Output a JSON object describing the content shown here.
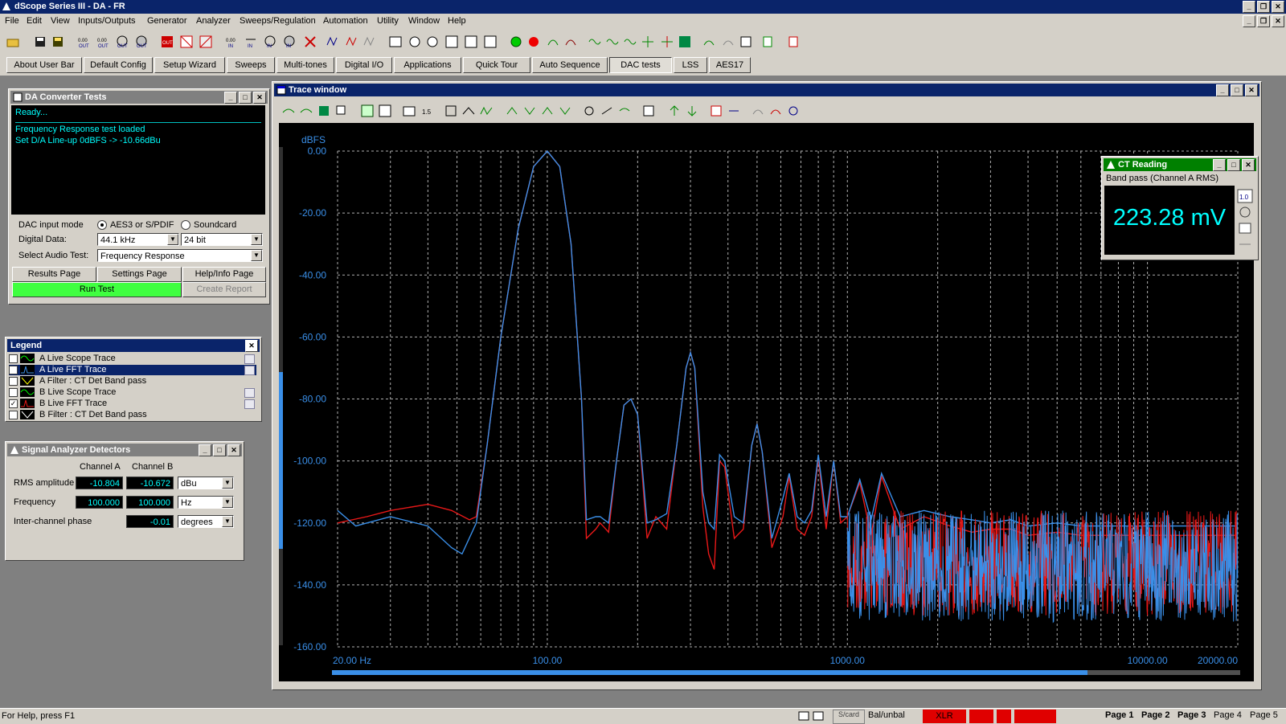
{
  "app": {
    "title": "dScope Series III - DA - FR",
    "menu": [
      "File",
      "Edit",
      "View",
      "Inputs/Outputs",
      "Generator",
      "Analyzer",
      "Sweeps/Regulation",
      "Automation",
      "Utility",
      "Window",
      "Help"
    ]
  },
  "user_bar": {
    "buttons": [
      "About User Bar",
      "Default Config",
      "Setup Wizard",
      "Sweeps",
      "Multi-tones",
      "Digital I/O",
      "Applications",
      "Quick Tour",
      "Auto Sequence",
      "DAC tests",
      "LSS",
      "AES17"
    ],
    "active": "DAC tests"
  },
  "da_panel": {
    "title": "DA Converter Tests",
    "log": [
      "Ready...",
      "Frequency Response test loaded",
      "Set D/A Line-up 0dBFS -> -10.66dBu"
    ],
    "dac_input_label": "DAC input mode",
    "dac_input_options": [
      "AES3 or S/PDIF",
      "Soundcard"
    ],
    "dac_input_selected": "AES3 or S/PDIF",
    "digital_data_label": "Digital Data:",
    "sample_rate": "44.1 kHz",
    "bit_depth": "24 bit",
    "select_test_label": "Select Audio Test:",
    "selected_test": "Frequency Response",
    "buttons": {
      "results": "Results Page",
      "settings": "Settings Page",
      "help": "Help/Info Page",
      "run": "Run Test",
      "report": "Create Report"
    }
  },
  "legend": {
    "title": "Legend",
    "items": [
      {
        "label": "A  Live Scope Trace",
        "checked": false
      },
      {
        "label": "A  Live FFT Trace",
        "checked": true,
        "selected": true
      },
      {
        "label": "A  Filter : CT Det Band pass",
        "checked": false
      },
      {
        "label": "B  Live Scope Trace",
        "checked": false
      },
      {
        "label": "B  Live FFT Trace",
        "checked": true
      },
      {
        "label": "B  Filter : CT Det Band pass",
        "checked": false
      }
    ]
  },
  "detectors": {
    "title": "Signal Analyzer Detectors",
    "col_a": "Channel A",
    "col_b": "Channel B",
    "rms_label": "RMS amplitude",
    "rms_a": "-10.804",
    "rms_b": "-10.672",
    "rms_unit": "dBu",
    "freq_label": "Frequency",
    "freq_a": "100.000",
    "freq_b": "100.000",
    "freq_unit": "Hz",
    "phase_label": "Inter-channel phase",
    "phase_val": "-0.01",
    "phase_unit": "degrees"
  },
  "trace_window": {
    "title": "Trace window"
  },
  "ct_reading": {
    "title": "CT Reading",
    "subtitle": "Band pass (Channel A RMS)",
    "value": "223.28 mV"
  },
  "chart_data": {
    "type": "line",
    "ylabel": "dBFS",
    "ylim": [
      -160,
      0
    ],
    "xlim": [
      20,
      20000
    ],
    "xscale": "log",
    "yticks": [
      "0.00",
      "-20.00",
      "-40.00",
      "-60.00",
      "-80.00",
      "-100.00",
      "-120.00",
      "-140.00",
      "-160.00"
    ],
    "xticks": [
      "20.00 Hz",
      "100.00",
      "1000.00",
      "10000.00",
      "20000.00"
    ],
    "grid": true,
    "colors": {
      "a": "#3a8fe8",
      "b": "#e81818"
    },
    "series": [
      {
        "key": "A",
        "points": [
          [
            20,
            -116
          ],
          [
            23,
            -121
          ],
          [
            30,
            -118
          ],
          [
            40,
            -121
          ],
          [
            48,
            -128
          ],
          [
            52,
            -130
          ],
          [
            58,
            -120
          ],
          [
            63,
            -95
          ],
          [
            70,
            -60
          ],
          [
            80,
            -25
          ],
          [
            90,
            -5
          ],
          [
            100,
            0
          ],
          [
            110,
            -5
          ],
          [
            120,
            -30
          ],
          [
            130,
            -80
          ],
          [
            135,
            -119
          ],
          [
            145,
            -118
          ],
          [
            150,
            -118
          ],
          [
            160,
            -120
          ],
          [
            170,
            -100
          ],
          [
            180,
            -82
          ],
          [
            190,
            -80
          ],
          [
            200,
            -85
          ],
          [
            215,
            -120
          ],
          [
            230,
            -119
          ],
          [
            250,
            -117
          ],
          [
            270,
            -95
          ],
          [
            290,
            -70
          ],
          [
            300,
            -65
          ],
          [
            310,
            -70
          ],
          [
            330,
            -110
          ],
          [
            345,
            -120
          ],
          [
            360,
            -122
          ],
          [
            375,
            -98
          ],
          [
            390,
            -100
          ],
          [
            420,
            -118
          ],
          [
            450,
            -120
          ],
          [
            480,
            -95
          ],
          [
            500,
            -88
          ],
          [
            520,
            -97
          ],
          [
            560,
            -125
          ],
          [
            610,
            -112
          ],
          [
            640,
            -104
          ],
          [
            680,
            -118
          ],
          [
            720,
            -120
          ],
          [
            760,
            -116
          ],
          [
            800,
            -98
          ],
          [
            850,
            -118
          ],
          [
            900,
            -100
          ],
          [
            950,
            -118
          ],
          [
            1000,
            -118
          ],
          [
            1100,
            -106
          ],
          [
            1200,
            -119
          ],
          [
            1300,
            -104
          ],
          [
            1500,
            -118
          ],
          [
            1800,
            -116
          ],
          [
            2200,
            -118
          ],
          [
            2600,
            -119
          ],
          [
            3000,
            -120
          ],
          [
            3500,
            -119
          ],
          [
            4000,
            -121
          ],
          [
            5000,
            -120
          ],
          [
            6000,
            -121
          ],
          [
            8000,
            -121
          ],
          [
            10000,
            -121
          ],
          [
            12000,
            -121
          ],
          [
            15000,
            -121
          ],
          [
            20000,
            -121
          ]
        ]
      },
      {
        "key": "B",
        "points": [
          [
            20,
            -120
          ],
          [
            25,
            -118
          ],
          [
            30,
            -116
          ],
          [
            40,
            -114
          ],
          [
            48,
            -116
          ],
          [
            55,
            -119
          ],
          [
            58,
            -118
          ],
          [
            63,
            -95
          ],
          [
            70,
            -60
          ],
          [
            80,
            -25
          ],
          [
            90,
            -5
          ],
          [
            100,
            0
          ],
          [
            110,
            -5
          ],
          [
            120,
            -30
          ],
          [
            130,
            -80
          ],
          [
            135,
            -125
          ],
          [
            145,
            -122
          ],
          [
            150,
            -120
          ],
          [
            160,
            -123
          ],
          [
            170,
            -100
          ],
          [
            180,
            -82
          ],
          [
            190,
            -80
          ],
          [
            200,
            -85
          ],
          [
            215,
            -125
          ],
          [
            230,
            -118
          ],
          [
            250,
            -122
          ],
          [
            270,
            -95
          ],
          [
            290,
            -70
          ],
          [
            300,
            -65
          ],
          [
            310,
            -70
          ],
          [
            330,
            -115
          ],
          [
            345,
            -130
          ],
          [
            360,
            -135
          ],
          [
            375,
            -100
          ],
          [
            390,
            -102
          ],
          [
            420,
            -125
          ],
          [
            450,
            -122
          ],
          [
            480,
            -95
          ],
          [
            500,
            -88
          ],
          [
            520,
            -97
          ],
          [
            560,
            -128
          ],
          [
            610,
            -118
          ],
          [
            640,
            -105
          ],
          [
            680,
            -122
          ],
          [
            720,
            -124
          ],
          [
            760,
            -118
          ],
          [
            800,
            -99
          ],
          [
            850,
            -122
          ],
          [
            900,
            -100
          ],
          [
            950,
            -120
          ],
          [
            1000,
            -118
          ],
          [
            1100,
            -107
          ],
          [
            1200,
            -124
          ],
          [
            1300,
            -105
          ],
          [
            1500,
            -122
          ],
          [
            1800,
            -118
          ],
          [
            2200,
            -121
          ],
          [
            2600,
            -123
          ],
          [
            3000,
            -122
          ],
          [
            3500,
            -122
          ],
          [
            4000,
            -124
          ],
          [
            5000,
            -123
          ],
          [
            6000,
            -124
          ],
          [
            8000,
            -124
          ],
          [
            10000,
            -124
          ],
          [
            12000,
            -124
          ],
          [
            15000,
            -124
          ],
          [
            20000,
            -124
          ]
        ]
      }
    ]
  },
  "status": {
    "help": "For Help, press F1",
    "scard": "S/card",
    "balunbal": "Bal/unbal",
    "xlr": "XLR",
    "pages": [
      "Page 1",
      "Page 2",
      "Page 3",
      "Page 4",
      "Page 5"
    ]
  }
}
